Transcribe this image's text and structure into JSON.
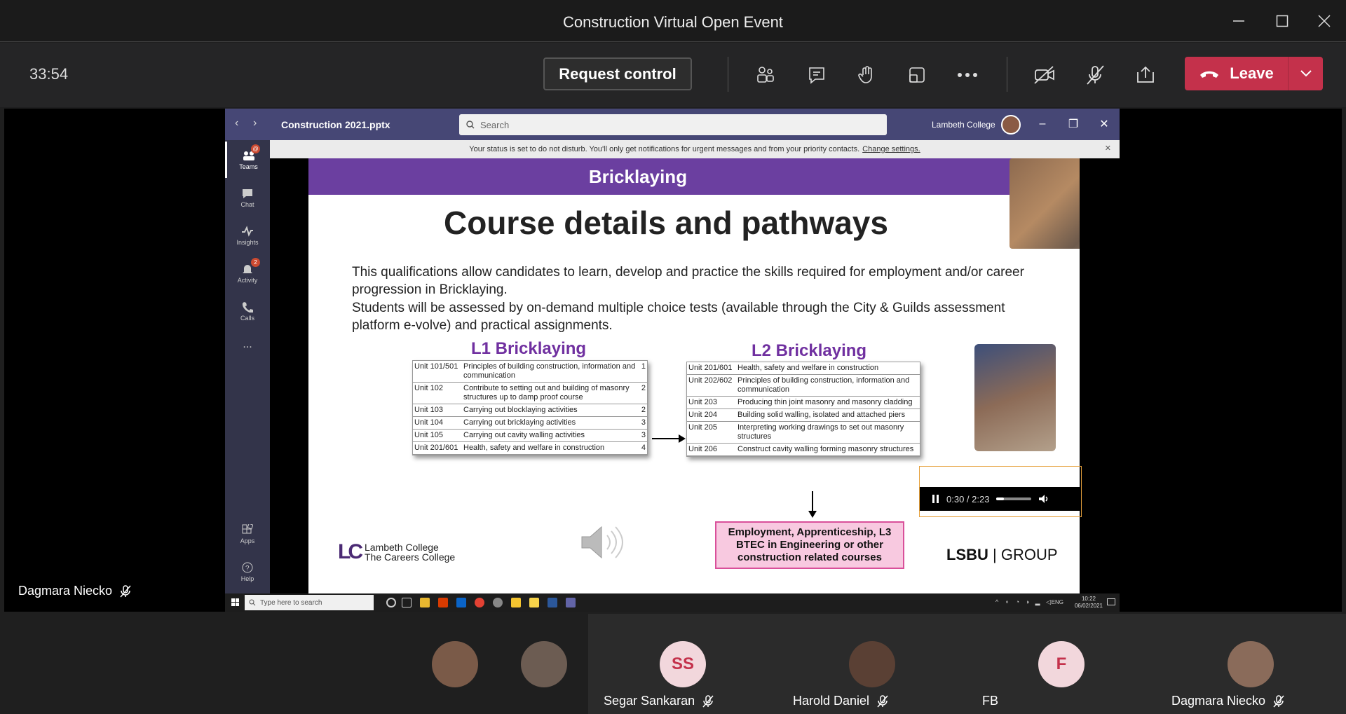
{
  "window": {
    "title": "Construction Virtual Open Event"
  },
  "toolbar": {
    "timer": "33:54",
    "request_control": "Request control",
    "leave_label": "Leave"
  },
  "stage": {
    "presenter_name": "Dagmara Niecko"
  },
  "share": {
    "file_name": "Construction 2021.pptx",
    "search_placeholder": "Search",
    "org_name": "Lambeth College",
    "notice_text": "Your status is set to do not disturb. You'll only get notifications for urgent messages and from your priority contacts.",
    "notice_link": "Change settings.",
    "rail": [
      {
        "label": "Teams",
        "badge": "@"
      },
      {
        "label": "Chat",
        "badge": ""
      },
      {
        "label": "Insights",
        "badge": ""
      },
      {
        "label": "Activity",
        "badge": "2"
      },
      {
        "label": "Calls",
        "badge": ""
      },
      {
        "label": "...",
        "badge": ""
      },
      {
        "label": "Apps",
        "badge": ""
      },
      {
        "label": "Help",
        "badge": ""
      }
    ],
    "taskbar": {
      "search_placeholder": "Type here to search",
      "lang": "ENG",
      "time": "10:22",
      "date": "06/02/2021"
    }
  },
  "slide": {
    "banner": "Bricklaying",
    "title": "Course details and pathways",
    "para1": "This qualifications  allow candidates to learn, develop and practice the skills required for employment and/or career progression in Bricklaying.",
    "para2": "Students will be assessed by on-demand multiple choice tests (available through the City & Guilds assessment platform e-volve) and practical assignments.",
    "l1_title": "L1 Bricklaying",
    "l2_title": "L2 Bricklaying",
    "l1_units": [
      {
        "unit": "Unit 101/501",
        "desc": "Principles of building construction, information and communication",
        "credit": "1"
      },
      {
        "unit": "Unit 102",
        "desc": "Contribute to setting out and building of masonry structures up to damp proof course",
        "credit": "2"
      },
      {
        "unit": "Unit 103",
        "desc": "Carrying out blocklaying activities",
        "credit": "2"
      },
      {
        "unit": "Unit 104",
        "desc": "Carrying out bricklaying activities",
        "credit": "3"
      },
      {
        "unit": "Unit 105",
        "desc": "Carrying out cavity walling activities",
        "credit": "3"
      },
      {
        "unit": "Unit 201/601",
        "desc": "Health, safety and welfare in construction",
        "credit": "4"
      }
    ],
    "l2_units": [
      {
        "unit": "Unit 201/601",
        "desc": "Health, safety and welfare in construction"
      },
      {
        "unit": "Unit 202/602",
        "desc": "Principles of building construction, information and communication"
      },
      {
        "unit": "Unit 203",
        "desc": "Producing thin joint masonry and masonry cladding"
      },
      {
        "unit": "Unit 204",
        "desc": "Building solid walling, isolated and attached piers"
      },
      {
        "unit": "Unit 205",
        "desc": "Interpreting working drawings to set out masonry structures"
      },
      {
        "unit": "Unit 206",
        "desc": "Construct cavity walling forming masonry structures"
      }
    ],
    "outcome": "Employment, Apprenticeship, L3 BTEC in Engineering or other construction related courses",
    "lc_name": "Lambeth College",
    "lc_tagline": "The Careers College",
    "lsbu_a": "LSBU",
    "lsbu_b": "| GROUP",
    "media_time": "0:30 / 2:23",
    "media_progress": 0.22
  },
  "participants": [
    {
      "name": "",
      "initials": "",
      "color": "#7a5a48"
    },
    {
      "name": "",
      "initials": "",
      "color": "#6c5c52"
    },
    {
      "name": "Segar Sankaran",
      "initials": "SS",
      "color": "#f2d7dc"
    },
    {
      "name": "Harold Daniel",
      "initials": "",
      "color": "#5a4034"
    },
    {
      "name": "FB",
      "initials": "F",
      "color": "#f2d7dc"
    },
    {
      "name": "Dagmara Niecko",
      "initials": "",
      "color": "#8a6b5a"
    }
  ],
  "colors": {
    "leave": "#c4314b",
    "teams_rail": "#33344a",
    "banner": "#6b3fa0",
    "level_title": "#7030a0"
  }
}
